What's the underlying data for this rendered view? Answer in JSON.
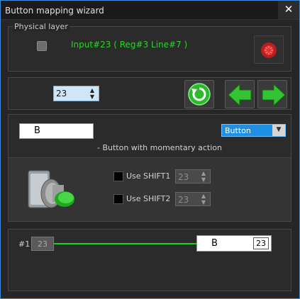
{
  "window": {
    "title": "Button mapping wizard",
    "close_glyph": "✕"
  },
  "physical": {
    "legend": "Physical layer",
    "input_text": "Input#23  ( Reg#3  Line#7 )"
  },
  "nav": {
    "input_number": "23",
    "refresh_icon": "refresh-icon",
    "prev_icon": "arrow-left-icon",
    "next_icon": "arrow-right-icon"
  },
  "mapping": {
    "key_value": "B",
    "type_selected": "Button",
    "description": "- Button with momentary action",
    "shift1_label": "Use SHIFT1",
    "shift1_value": "23",
    "shift2_label": "Use SHIFT2",
    "shift2_value": "23"
  },
  "chain": {
    "index_label": "#1",
    "source_value": "23",
    "target_key": "B",
    "target_value": "23"
  },
  "colors": {
    "accent_blue": "#1e90e6",
    "green": "#27d427",
    "window_border": "#3b8fd8"
  }
}
